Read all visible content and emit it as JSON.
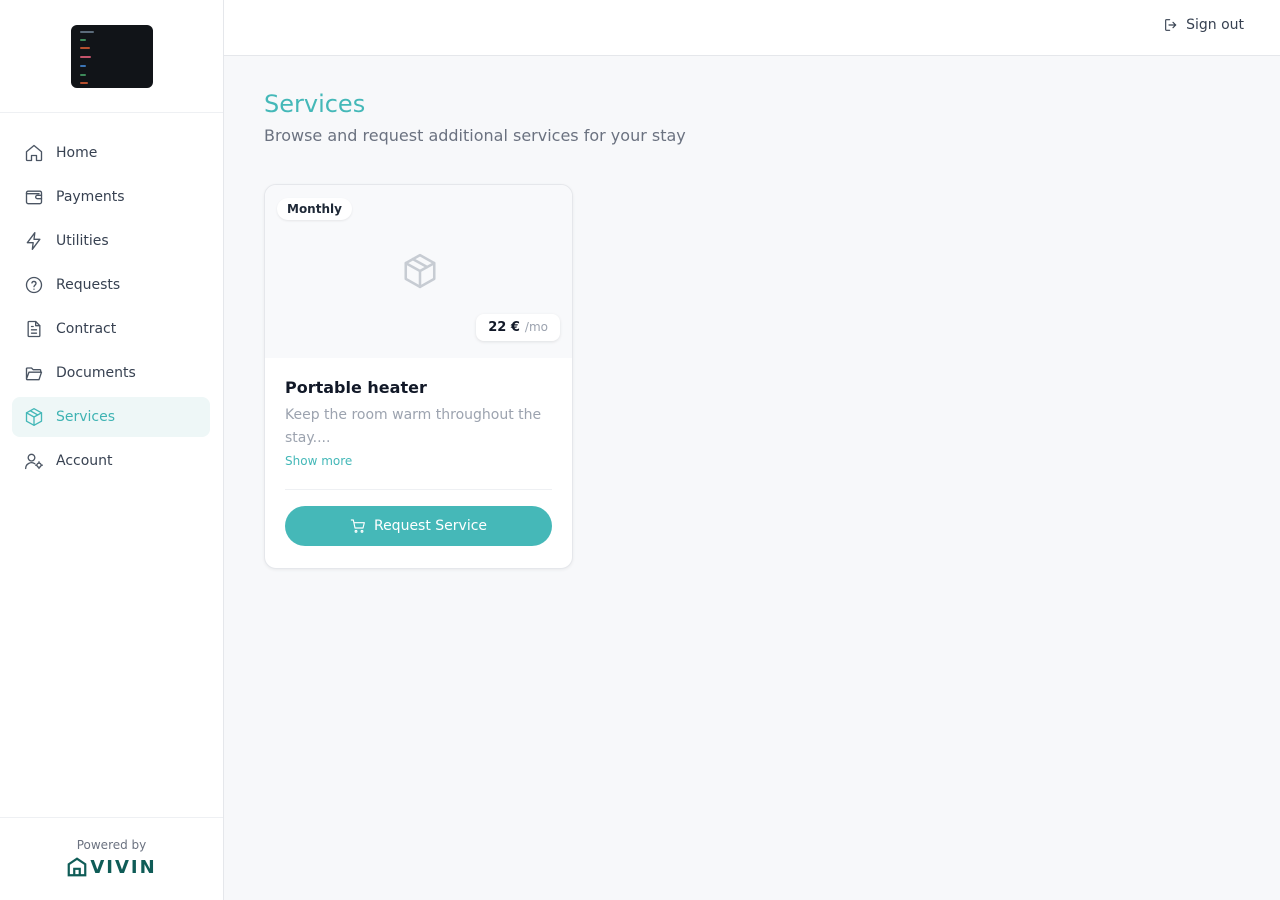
{
  "sidebar": {
    "logo_icon": "property-logo",
    "items": [
      {
        "label": "Home",
        "icon": "home-icon"
      },
      {
        "label": "Payments",
        "icon": "wallet-icon"
      },
      {
        "label": "Utilities",
        "icon": "lightning-icon"
      },
      {
        "label": "Requests",
        "icon": "help-circle-icon"
      },
      {
        "label": "Contract",
        "icon": "document-icon"
      },
      {
        "label": "Documents",
        "icon": "folder-icon"
      },
      {
        "label": "Services",
        "icon": "box-icon",
        "active": true
      },
      {
        "label": "Account",
        "icon": "user-settings-icon"
      }
    ],
    "footer": {
      "powered_by": "Powered by",
      "brand": "VIVIN"
    }
  },
  "topbar": {
    "sign_out": "Sign out"
  },
  "main": {
    "title": "Services",
    "subtitle": "Browse and request additional services for your stay",
    "services": [
      {
        "frequency": "Monthly",
        "price": "22 €",
        "price_unit": "/mo",
        "title": "Portable heater",
        "description": "Keep the room warm throughout the stay....",
        "show_more": "Show more",
        "request_label": "Request Service"
      }
    ]
  },
  "colors": {
    "accent": "#44b8b8",
    "active_bg": "#eef7f7",
    "brand": "#0f5c57"
  }
}
